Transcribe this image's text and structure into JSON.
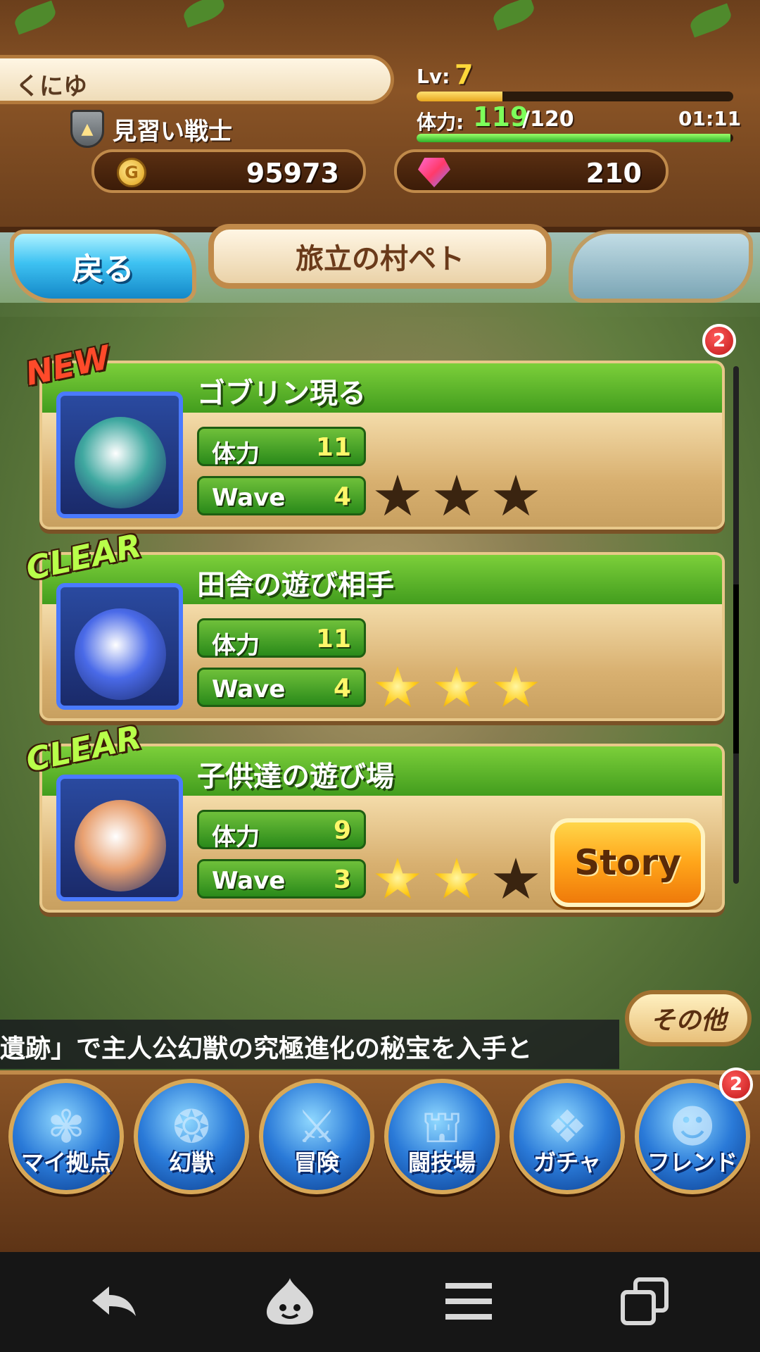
{
  "player": {
    "name": "くにゆ",
    "rank_title": "見習い戦士",
    "level_label": "Lv:",
    "level": "7",
    "level_progress": 0.27
  },
  "stamina": {
    "label": "体力:",
    "current": "119",
    "max": "/120",
    "timer": "01:11",
    "progress": 0.99
  },
  "currency": {
    "gold": "95973",
    "gems": "210"
  },
  "nav": {
    "back_label": "戻る",
    "location": "旅立の村ペト",
    "badge_count": "2"
  },
  "quests": [
    {
      "tag": "NEW",
      "name": "ゴブリン現る",
      "stamina_label": "体力",
      "stamina_cost": "11",
      "wave_label": "Wave",
      "waves": "4",
      "stars": 0,
      "portrait_color": "#3fa8a0"
    },
    {
      "tag": "CLEAR",
      "name": "田舎の遊び相手",
      "stamina_label": "体力",
      "stamina_cost": "11",
      "wave_label": "Wave",
      "waves": "4",
      "stars": 3,
      "portrait_color": "#4a6ae8"
    },
    {
      "tag": "CLEAR",
      "name": "子供達の遊び場",
      "stamina_label": "体力",
      "stamina_cost": "9",
      "wave_label": "Wave",
      "waves": "3",
      "stars": 2,
      "portrait_color": "#e8a070",
      "story_label": "Story"
    }
  ],
  "ticker": {
    "text": "遺跡」で主人公幻獣の究極進化の秘宝を入手と"
  },
  "other_label": "その他",
  "menu": [
    {
      "label": "マイ拠点",
      "icon": "home-crest-icon",
      "glyph": "✾"
    },
    {
      "label": "幻獣",
      "icon": "beast-icon",
      "glyph": "❂"
    },
    {
      "label": "冒険",
      "icon": "crossed-swords-icon",
      "glyph": "⚔"
    },
    {
      "label": "闘技場",
      "icon": "arena-icon",
      "glyph": "⛫"
    },
    {
      "label": "ガチャ",
      "icon": "gacha-icon",
      "glyph": "❖"
    },
    {
      "label": "フレンド",
      "icon": "friends-icon",
      "glyph": "☻",
      "badge": "2"
    }
  ],
  "system_nav": [
    "back-arrow-icon",
    "slime-icon",
    "menu-icon",
    "recent-apps-icon"
  ],
  "colors": {
    "accent_green": "#3f9a1c",
    "accent_blue": "#3ec2f2",
    "frame_brown": "#8a5426",
    "story_orange": "#ffa51a"
  }
}
